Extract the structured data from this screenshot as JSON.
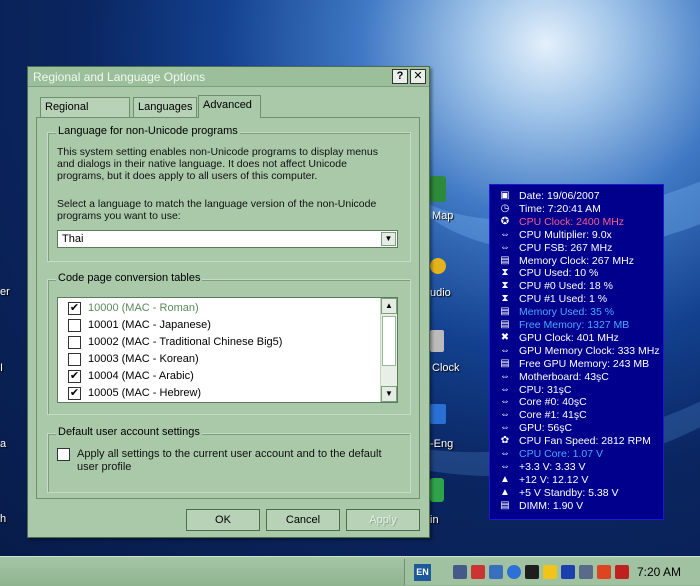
{
  "dialog": {
    "title": "Regional and Language Options",
    "help_btn": "?",
    "close_btn": "✕",
    "tabs": [
      "Regional Options",
      "Languages",
      "Advanced"
    ],
    "non_unicode": {
      "legend": "Language for non-Unicode programs",
      "desc": [
        "This system setting enables non-Unicode programs to display menus",
        "and dialogs in their native language. It does not affect Unicode",
        "programs, but it does apply to all users of this computer."
      ],
      "prompt": [
        "Select a language to match the language version of the non-Unicode",
        "programs you want to use:"
      ],
      "selected_language": "Thai"
    },
    "code_page": {
      "legend": "Code page conversion tables",
      "items": [
        {
          "label": "10000 (MAC - Roman)",
          "checked": true
        },
        {
          "label": "10001 (MAC - Japanese)",
          "checked": false
        },
        {
          "label": "10002 (MAC - Traditional Chinese Big5)",
          "checked": false
        },
        {
          "label": "10003 (MAC - Korean)",
          "checked": false
        },
        {
          "label": "10004 (MAC - Arabic)",
          "checked": true
        },
        {
          "label": "10005 (MAC - Hebrew)",
          "checked": true
        }
      ]
    },
    "default_user": {
      "legend": "Default user account settings",
      "line1": "Apply all settings to the current user account and to the default",
      "line2": "user profile"
    },
    "buttons": {
      "ok": "OK",
      "cancel": "Cancel",
      "apply": "Apply"
    }
  },
  "sensors": [
    {
      "icon": "calendar-icon",
      "glyph": "▣",
      "text": "Date: 19/06/2007",
      "color": "#ffffff"
    },
    {
      "icon": "clock-icon",
      "glyph": "◷",
      "text": "Time: 7:20:41 AM",
      "color": "#ffffff"
    },
    {
      "icon": "cpu-icon",
      "glyph": "✪",
      "text": "CPU Clock: 2400 MHz",
      "color": "#ff5c8a"
    },
    {
      "icon": "arrows-icon",
      "glyph": "⇔",
      "text": "CPU Multiplier: 9.0x",
      "color": "#ffffff"
    },
    {
      "icon": "arrows-icon",
      "glyph": "⇔",
      "text": "CPU FSB: 267 MHz",
      "color": "#ffffff"
    },
    {
      "icon": "memory-icon",
      "glyph": "▤",
      "text": "Memory Clock: 267 MHz",
      "color": "#ffffff"
    },
    {
      "icon": "hourglass-icon",
      "glyph": "⧗",
      "text": "CPU Used: 10 %",
      "color": "#ffffff"
    },
    {
      "icon": "hourglass-icon",
      "glyph": "⧗",
      "text": "CPU #0 Used: 18 %",
      "color": "#ffffff"
    },
    {
      "icon": "hourglass-icon",
      "glyph": "⧗",
      "text": "CPU #1 Used: 1 %",
      "color": "#ffffff"
    },
    {
      "icon": "memory-icon",
      "glyph": "▤",
      "text": "Memory Used: 35 %",
      "color": "#4aa8ff"
    },
    {
      "icon": "memory-icon",
      "glyph": "▤",
      "text": "Free Memory: 1327 MB",
      "color": "#4aa8ff"
    },
    {
      "icon": "gpu-icon",
      "glyph": "✖",
      "text": "GPU Clock: 401 MHz",
      "color": "#ffffff"
    },
    {
      "icon": "arrows-icon",
      "glyph": "⇔",
      "text": "GPU Memory Clock: 333 MHz",
      "color": "#ffffff"
    },
    {
      "icon": "memory-icon",
      "glyph": "▤",
      "text": "Free GPU Memory: 243 MB",
      "color": "#ffffff"
    },
    {
      "icon": "arrows-icon",
      "glyph": "⇔",
      "text": "Motherboard: 43şC",
      "color": "#ffffff"
    },
    {
      "icon": "arrows-icon",
      "glyph": "⇔",
      "text": "CPU: 31şC",
      "color": "#ffffff"
    },
    {
      "icon": "arrows-icon",
      "glyph": "⇔",
      "text": "Core #0: 40şC",
      "color": "#ffffff"
    },
    {
      "icon": "arrows-icon",
      "glyph": "⇔",
      "text": "Core #1: 41şC",
      "color": "#ffffff"
    },
    {
      "icon": "arrows-icon",
      "glyph": "⇔",
      "text": "GPU: 56şC",
      "color": "#ffffff"
    },
    {
      "icon": "fan-icon",
      "glyph": "✿",
      "text": "CPU Fan Speed: 2812 RPM",
      "color": "#ffffff"
    },
    {
      "icon": "arrows-icon",
      "glyph": "⇔",
      "text": "CPU Core: 1.07 V",
      "color": "#4aa8ff"
    },
    {
      "icon": "arrows-icon",
      "glyph": "⇔",
      "text": "+3.3 V: 3.33 V",
      "color": "#ffffff"
    },
    {
      "icon": "warning-icon",
      "glyph": "▲",
      "text": "+12 V: 12.12 V",
      "color": "#ffffff"
    },
    {
      "icon": "warning-icon",
      "glyph": "▲",
      "text": "+5 V Standby: 5.38 V",
      "color": "#ffffff"
    },
    {
      "icon": "memory-icon",
      "glyph": "▤",
      "text": "DIMM: 1.90 V",
      "color": "#ffffff"
    }
  ],
  "desktop_labels": {
    "map": "Map",
    "audio": "udio",
    "clock": "Clock",
    "eng": "-Eng",
    "in": "in",
    "left_er": "er",
    "left_i": "I",
    "left_a": "a",
    "left_h": "h"
  },
  "taskbar": {
    "lang": "EN",
    "time": "7:20 AM"
  }
}
